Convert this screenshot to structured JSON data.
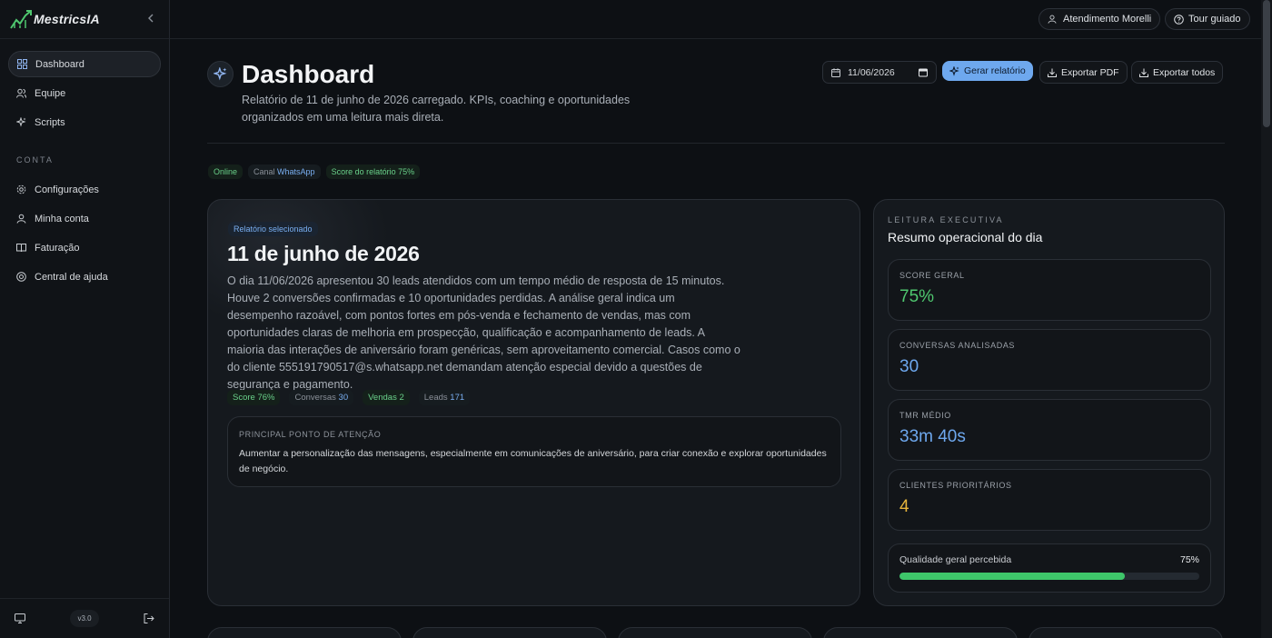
{
  "brand": {
    "name": "MestricsIA"
  },
  "sidebar": {
    "items": [
      {
        "label": "Dashboard",
        "icon": "grid-icon"
      },
      {
        "label": "Equipe",
        "icon": "users-icon"
      },
      {
        "label": "Scripts",
        "icon": "sparkle-icon"
      }
    ],
    "section_label": "CONTA",
    "account_items": [
      {
        "label": "Configurações",
        "icon": "gear-icon"
      },
      {
        "label": "Minha conta",
        "icon": "user-icon"
      },
      {
        "label": "Faturação",
        "icon": "book-icon"
      },
      {
        "label": "Central de ajuda",
        "icon": "help-icon"
      }
    ],
    "version": "v3.0"
  },
  "topbar": {
    "account_label": "Atendimento Morelli",
    "tour_label": "Tour guiado"
  },
  "header": {
    "title": "Dashboard",
    "description": "Relatório de 11 de junho de 2026 carregado. KPIs, coaching e oportunidades organizados em uma leitura mais direta.",
    "date_value": "11/06/2026",
    "generate_label": "Gerar relatório",
    "export_pdf_label": "Exportar PDF",
    "export_all_label": "Exportar todos"
  },
  "status_chips": {
    "online": "Online",
    "channel_label": "Canal",
    "channel_value": "WhatsApp",
    "score_label": "Score do relatório",
    "score_value": "75%"
  },
  "report": {
    "badge": "Relatório selecionado",
    "title": "11 de junho de 2026",
    "summary": "O dia 11/06/2026 apresentou 30 leads atendidos com um tempo médio de resposta de 15 minutos. Houve 2 conversões confirmadas e 10 oportunidades perdidas. A análise geral indica um desempenho razoável, com pontos fortes em pós-venda e fechamento de vendas, mas com oportunidades claras de melhoria em prospecção, qualificação e acompanhamento de leads. A maioria das interações de aniversário foram genéricas, sem aproveitamento comercial. Casos como o do cliente 555191790517@s.whatsapp.net demandam atenção especial devido a questões de segurança e pagamento.",
    "chips": [
      {
        "label": "Score",
        "value": "76%"
      },
      {
        "label": "Conversas",
        "value": "30"
      },
      {
        "label": "Vendas",
        "value": "2"
      },
      {
        "label": "Leads",
        "value": "171"
      }
    ],
    "attention_label": "PRINCIPAL PONTO DE ATENÇÃO",
    "attention_text": "Aumentar a personalização das mensagens, especialmente em comunicações de aniversário, para criar conexão e explorar oportunidades de negócio."
  },
  "executive": {
    "kicker": "LEITURA EXECUTIVA",
    "title": "Resumo operacional do dia",
    "kpis": [
      {
        "label": "SCORE GERAL",
        "value": "75%",
        "color": "#4fc76f"
      },
      {
        "label": "CONVERSAS ANALISADAS",
        "value": "30",
        "color": "#6ea8ee"
      },
      {
        "label": "TMR MÉDIO",
        "value": "33m 40s",
        "color": "#6ea8ee"
      },
      {
        "label": "CLIENTES PRIORITÁRIOS",
        "value": "4",
        "color": "#e7b53c"
      }
    ],
    "quality_label": "Qualidade geral percebida",
    "quality_value": "75%",
    "quality_fraction": 0.75
  },
  "colors": {
    "accent": "#6ea8ee",
    "success": "#3ec66a",
    "warning": "#e7b53c"
  }
}
